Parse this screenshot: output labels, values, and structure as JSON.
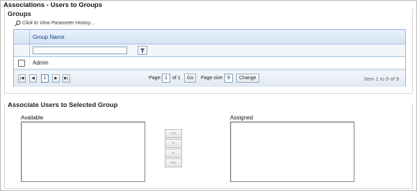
{
  "page": {
    "title": "Associations - Users to Groups"
  },
  "groups": {
    "section_title": "Groups",
    "history_link": "Click to View Parameter History...",
    "grid": {
      "column_header": "Group Name",
      "filter_value": "",
      "rows": [
        {
          "checked": false,
          "group_name": "Admin"
        }
      ]
    },
    "pager": {
      "first_icon": "first-page-icon",
      "prev_icon": "prev-page-icon",
      "current_page_button": "1",
      "next_icon": "next-page-icon",
      "last_icon": "last-page-icon",
      "page_label": "Page:",
      "page_value": "1",
      "of_label": "of 1",
      "go_label": "Go",
      "page_size_label": "Page size:",
      "page_size_value": "9",
      "change_label": "Change",
      "items_info": "Item 1 to 9 of 9"
    }
  },
  "associate": {
    "section_title": "Associate Users to Selected Group",
    "available_label": "Available",
    "assigned_label": "Assigned",
    "buttons": {
      "move_all_right": ">>",
      "move_right": ">",
      "move_left": "<",
      "move_all_left": "<<"
    }
  }
}
